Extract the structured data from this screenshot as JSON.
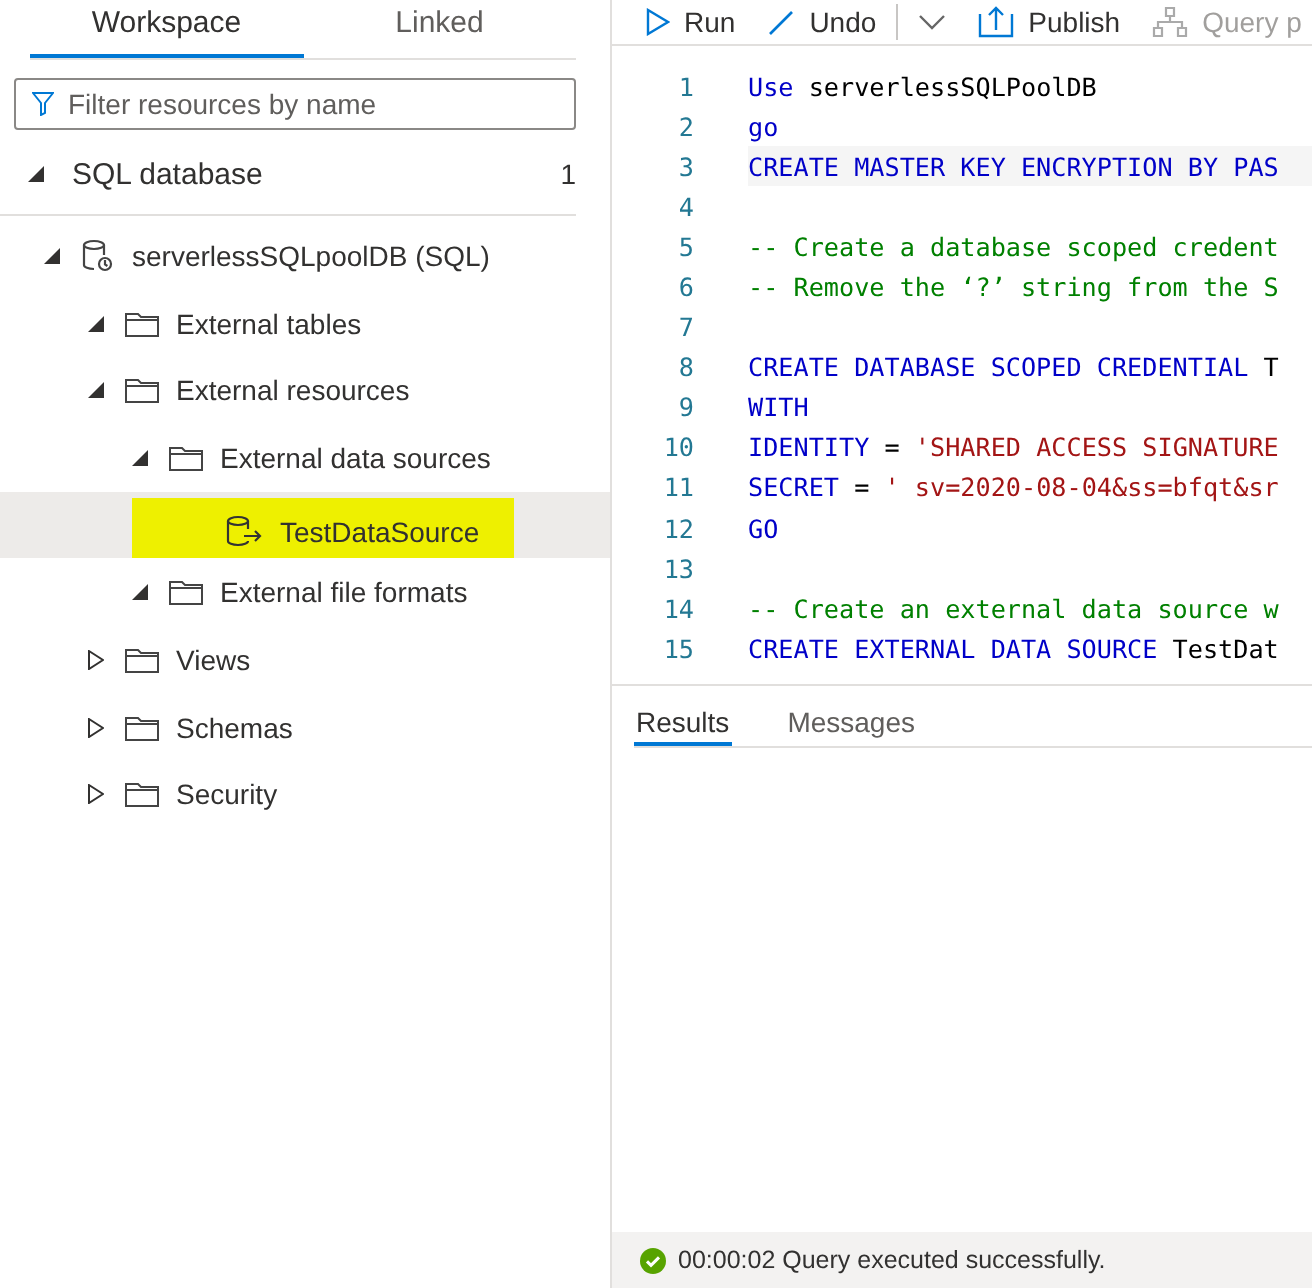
{
  "sidebar": {
    "tabs": [
      {
        "label": "Workspace",
        "selected": true
      },
      {
        "label": "Linked",
        "selected": false
      }
    ],
    "filter": {
      "placeholder": "Filter resources by name"
    },
    "section": {
      "label": "SQL database",
      "count": "1",
      "expanded": true
    },
    "tree": [
      {
        "label": "serverlessSQLpoolDB (SQL)",
        "kind": "database",
        "expanded": true,
        "selected": false,
        "children": [
          {
            "label": "External tables",
            "kind": "folder",
            "expanded": true,
            "selected": false
          },
          {
            "label": "External resources",
            "kind": "folder",
            "expanded": true,
            "selected": false,
            "children": [
              {
                "label": "External data sources",
                "kind": "folder",
                "expanded": true,
                "selected": false,
                "children": [
                  {
                    "label": "TestDataSource",
                    "kind": "datasource",
                    "selected": true,
                    "highlighted": true
                  }
                ]
              },
              {
                "label": "External file formats",
                "kind": "folder",
                "expanded": true,
                "selected": false
              }
            ]
          },
          {
            "label": "Views",
            "kind": "folder",
            "expanded": false,
            "selected": false
          },
          {
            "label": "Schemas",
            "kind": "folder",
            "expanded": false,
            "selected": false
          },
          {
            "label": "Security",
            "kind": "folder",
            "expanded": false,
            "selected": false
          }
        ]
      }
    ]
  },
  "toolbar": [
    {
      "label": "Run",
      "kind": "run"
    },
    {
      "label": "Undo",
      "kind": "undo"
    },
    {
      "kind": "dropdown"
    },
    {
      "label": "Publish",
      "kind": "publish"
    },
    {
      "label": "Query p",
      "kind": "query",
      "disabled": true
    }
  ],
  "editor": {
    "lines": [
      {
        "number": "1",
        "tokens": [
          {
            "kind": "keyword",
            "text": "Use"
          },
          {
            "kind": "plain",
            "text": " serverlessSQLPoolDB"
          }
        ]
      },
      {
        "number": "2",
        "tokens": [
          {
            "kind": "keyword",
            "text": "go"
          }
        ]
      },
      {
        "number": "3",
        "current": true,
        "tokens": [
          {
            "kind": "keyword",
            "text": "CREATE MASTER KEY ENCRYPTION BY PAS"
          }
        ]
      },
      {
        "number": "4"
      },
      {
        "number": "5",
        "tokens": [
          {
            "kind": "comment",
            "text": "-- Create a database scoped credent"
          }
        ]
      },
      {
        "number": "6",
        "tokens": [
          {
            "kind": "comment",
            "text": "-- Remove the ‘?’ string from the S"
          }
        ]
      },
      {
        "number": "7"
      },
      {
        "number": "8",
        "tokens": [
          {
            "kind": "keyword",
            "text": "CREATE DATABASE SCOPED CREDENTIAL"
          },
          {
            "kind": "plain",
            "text": " T"
          }
        ]
      },
      {
        "number": "9",
        "tokens": [
          {
            "kind": "keyword",
            "text": "WITH"
          }
        ]
      },
      {
        "number": "10",
        "tokens": [
          {
            "kind": "keyword",
            "text": "IDENTITY"
          },
          {
            "kind": "plain",
            "text": " = "
          },
          {
            "kind": "string",
            "text": "'SHARED ACCESS SIGNATURE"
          }
        ]
      },
      {
        "number": "11",
        "tokens": [
          {
            "kind": "keyword",
            "text": "SECRET"
          },
          {
            "kind": "plain",
            "text": " = "
          },
          {
            "kind": "string",
            "text": "' sv=2020-08-04&ss=bfqt&sr"
          }
        ]
      },
      {
        "number": "12",
        "tokens": [
          {
            "kind": "keyword",
            "text": "GO"
          }
        ]
      },
      {
        "number": "13"
      },
      {
        "number": "14",
        "tokens": [
          {
            "kind": "comment",
            "text": "-- Create an external data source w"
          }
        ]
      },
      {
        "number": "15",
        "tokens": [
          {
            "kind": "keyword",
            "text": "CREATE EXTERNAL DATA SOURCE"
          },
          {
            "kind": "plain",
            "text": " TestDat"
          }
        ]
      }
    ]
  },
  "results": {
    "tabs": [
      {
        "label": "Results",
        "selected": true
      },
      {
        "label": "Messages",
        "selected": false
      }
    ]
  },
  "status_bar": {
    "kind": "success",
    "text": "00:00:02 Query executed successfully."
  }
}
